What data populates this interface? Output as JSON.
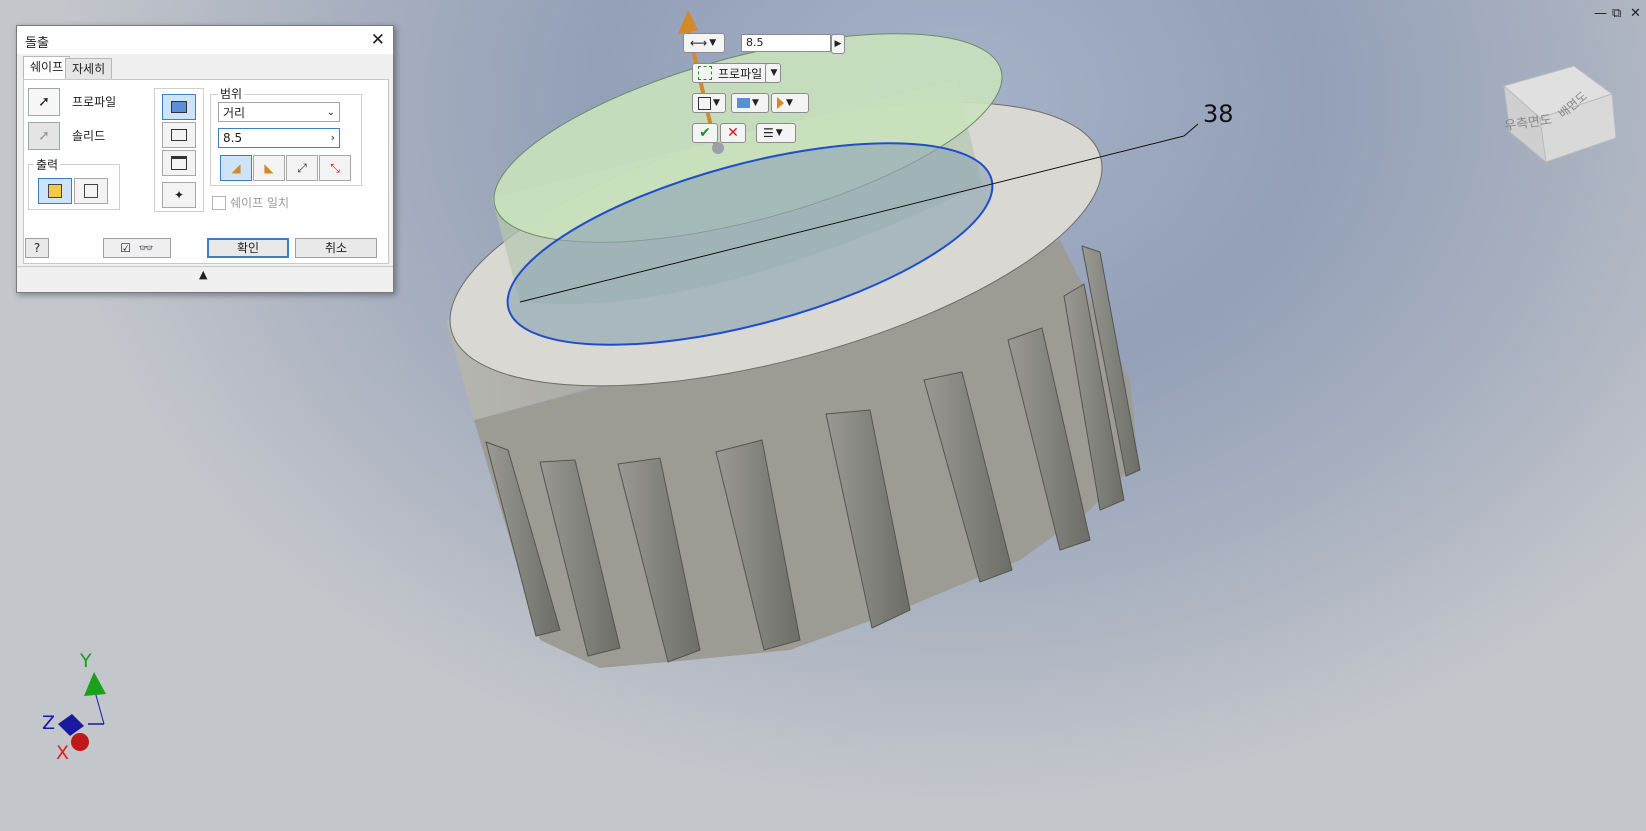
{
  "window_controls": {
    "minimize": "—",
    "restore": "⧉",
    "close": "✕"
  },
  "dialog": {
    "title": "돌출",
    "tabs": [
      "쉐이프",
      "자세히"
    ],
    "profile_label": "프로파일",
    "solid_label": "솔리드",
    "output_label": "출력",
    "extents_label": "범위",
    "extents_type": "거리",
    "distance_value": "8.5",
    "match_shape_label": "쉐이프 일치",
    "ok_label": "확인",
    "cancel_label": "취소"
  },
  "mini_toolbar": {
    "distance_value": "8.5",
    "profile_label": "프로파일"
  },
  "dimension_label": "38",
  "viewcube": {
    "front_face": "우측면도",
    "side_face": "배면도"
  },
  "axes": {
    "x": "X",
    "y": "Y",
    "z": "Z"
  },
  "colors": {
    "accent": "#3c7fc2",
    "part": "#a0a09a",
    "preview_fill": "#c8e3b8",
    "arrow": "#d4882a",
    "axis_x": "#e02020",
    "axis_y": "#1aa01a",
    "axis_z": "#1a1aa0"
  }
}
